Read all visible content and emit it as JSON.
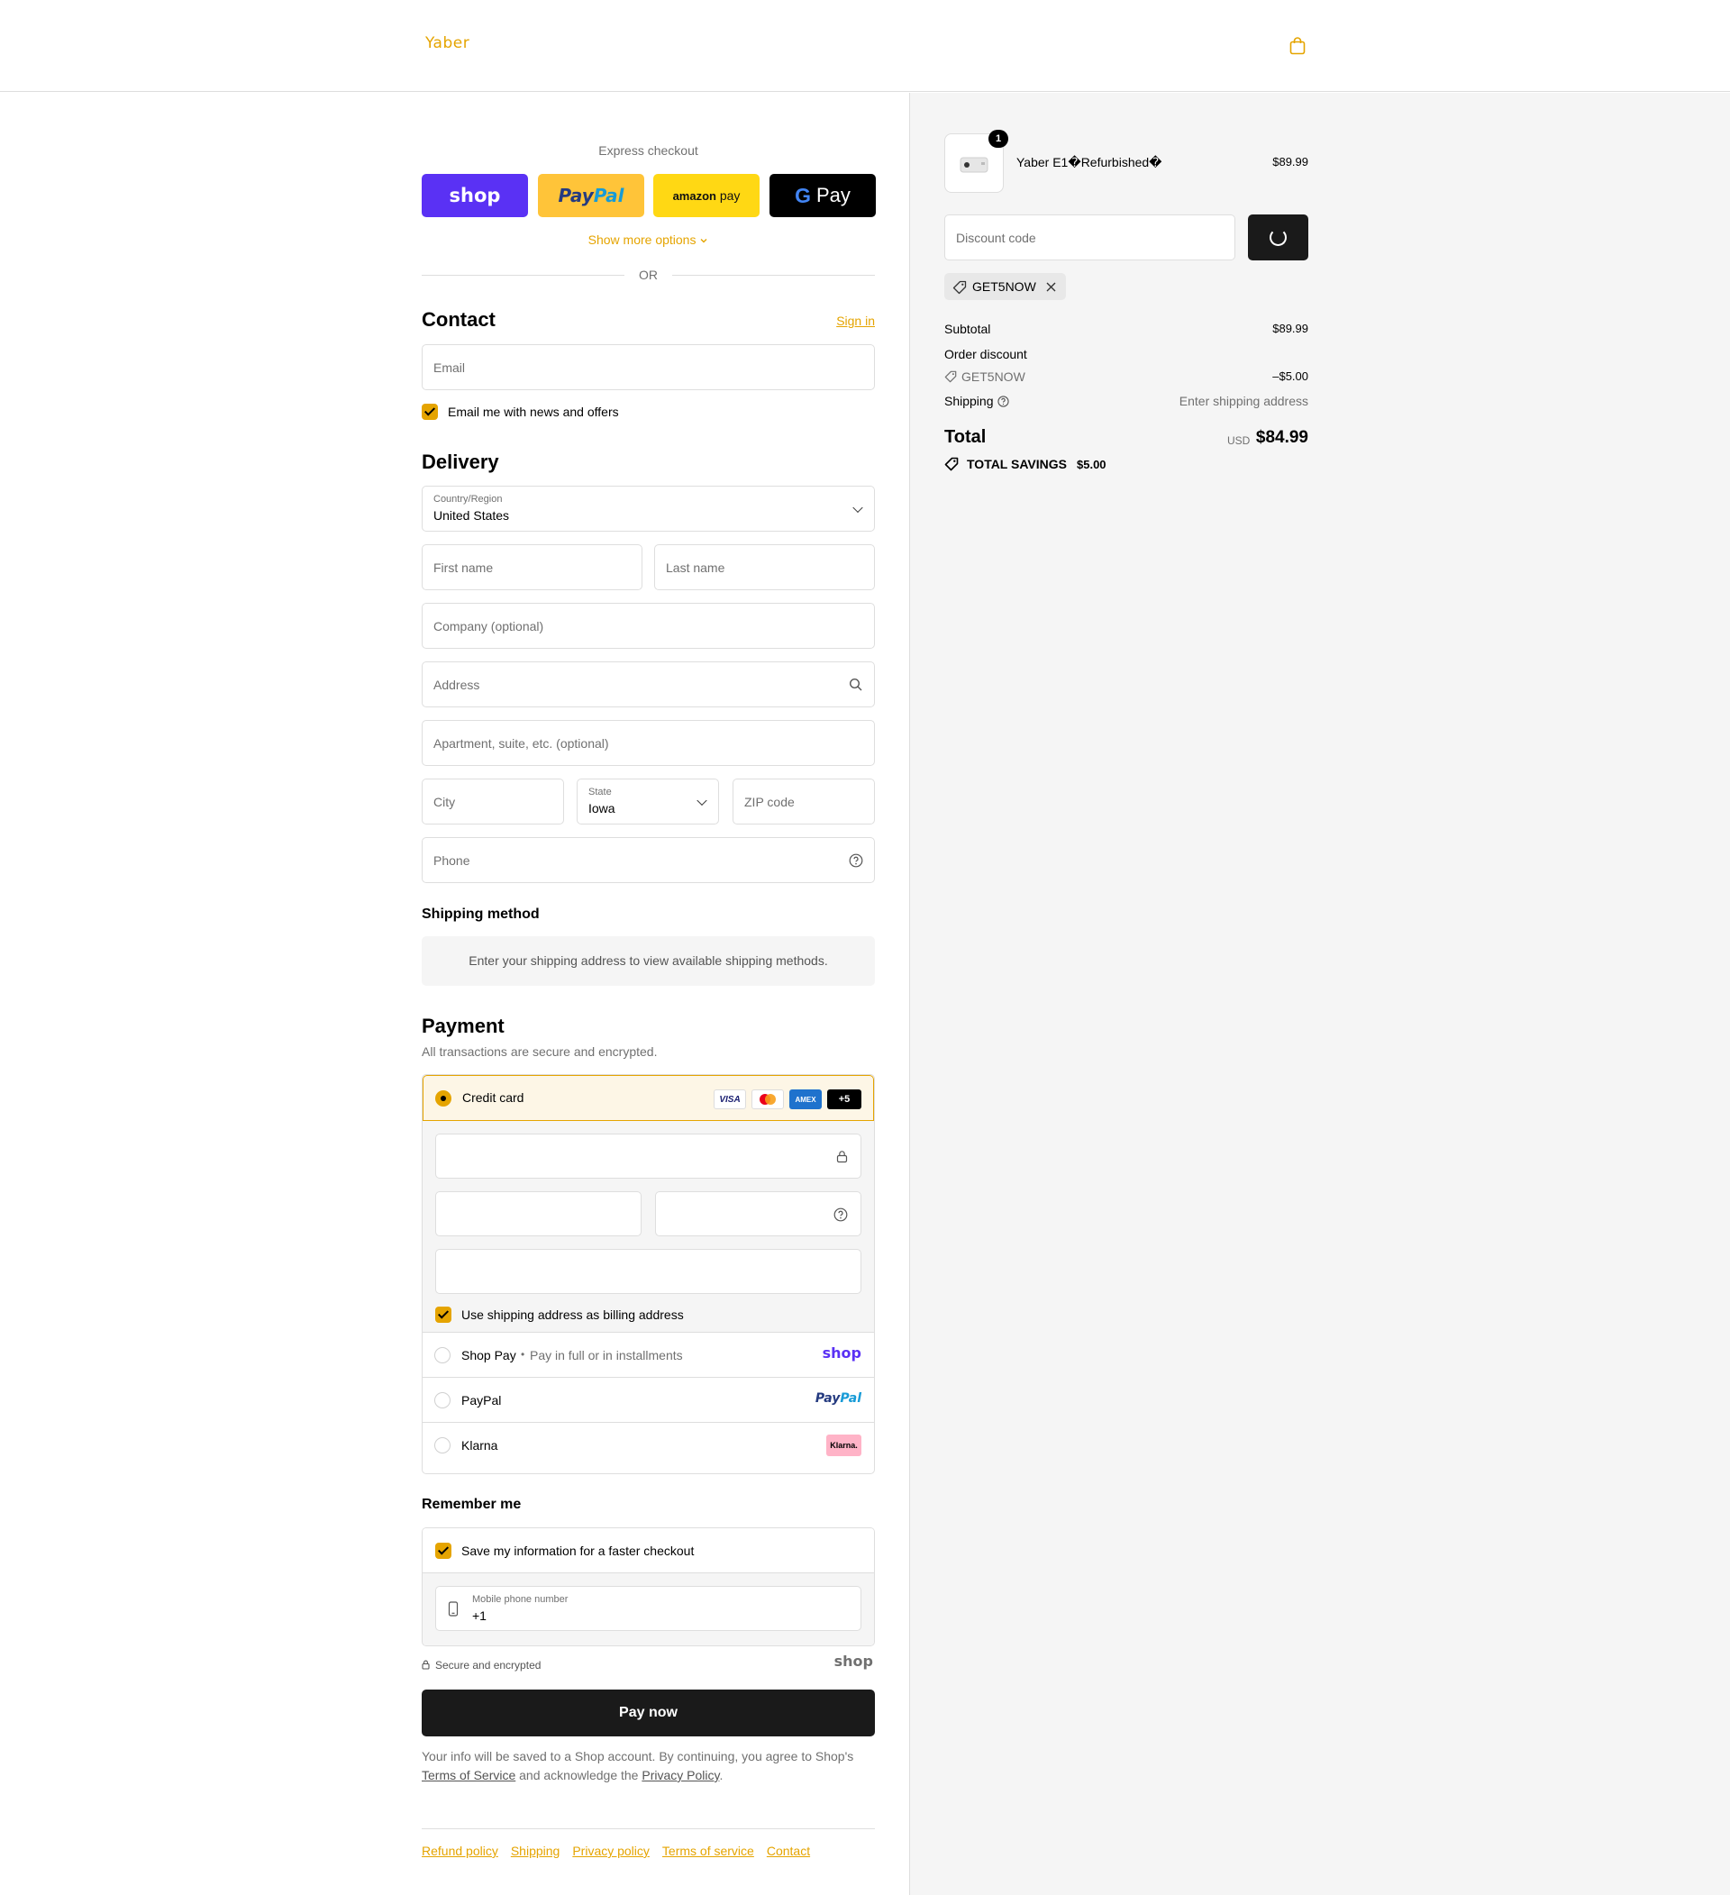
{
  "header": {
    "logo": "Yaber",
    "cart_icon": "shopping-bag-icon"
  },
  "express": {
    "title": "Express checkout",
    "shop_label": "shop",
    "paypal_a": "Pay",
    "paypal_b": "Pal",
    "amazon_a": "amazon",
    "amazon_b": " pay",
    "gpay_g": "G",
    "gpay_label": "Pay",
    "more_options": "Show more options",
    "or": "OR"
  },
  "contact": {
    "title": "Contact",
    "sign_in": "Sign in",
    "email_placeholder": "Email",
    "news_label": "Email me with news and offers"
  },
  "delivery": {
    "title": "Delivery",
    "country_label": "Country/Region",
    "country_value": "United States",
    "first_name": "First name",
    "last_name": "Last name",
    "company": "Company (optional)",
    "address": "Address",
    "apartment": "Apartment, suite, etc. (optional)",
    "city": "City",
    "state_label": "State",
    "state_value": "Iowa",
    "zip": "ZIP code",
    "phone": "Phone"
  },
  "shipping": {
    "title": "Shipping method",
    "message": "Enter your shipping address to view available shipping methods."
  },
  "payment": {
    "title": "Payment",
    "subtitle": "All transactions are secure and encrypted.",
    "credit_card": "Credit card",
    "card_logos": {
      "visa": "VISA",
      "amex": "AMEX",
      "more": "+5"
    },
    "billing_same": "Use shipping address as billing address",
    "shop_pay": "Shop Pay",
    "shop_pay_sep": "•",
    "shop_pay_desc": "Pay in full or in installments",
    "shop_pay_logo": "shop",
    "paypal": "PayPal",
    "paypal_logo_a": "Pay",
    "paypal_logo_b": "Pal",
    "klarna": "Klarna",
    "klarna_logo": "Klarna."
  },
  "remember": {
    "title": "Remember me",
    "save_label": "Save my information for a faster checkout",
    "mobile_label": "Mobile phone number",
    "mobile_value": "+1",
    "secure": "Secure and encrypted",
    "shop_logo": "shop"
  },
  "pay_now": "Pay now",
  "legal": {
    "part1": "Your info will be saved to a Shop account. By continuing, you agree to Shop's",
    "tos": "Terms of Service",
    "part2": " and acknowledge the ",
    "privacy": "Privacy Policy",
    "part3": "."
  },
  "footer_links": [
    "Refund policy",
    "Shipping",
    "Privacy policy",
    "Terms of service",
    "Contact"
  ],
  "summary": {
    "quantity": "1",
    "product_name": "Yaber E1�Refurbished�",
    "product_price": "$89.99",
    "discount_placeholder": "Discount code",
    "applied_code": "GET5NOW",
    "subtotal_label": "Subtotal",
    "subtotal_value": "$89.99",
    "order_discount_label": "Order discount",
    "discount_code": "GET5NOW",
    "discount_value": "–$5.00",
    "shipping_label": "Shipping",
    "shipping_value": "Enter shipping address",
    "total_label": "Total",
    "currency": "USD",
    "total_value": "$84.99",
    "savings_label": "TOTAL SAVINGS",
    "savings_value": "$5.00"
  },
  "colors": {
    "accent": "#e5a400",
    "shop_purple": "#5a31f4",
    "dark": "#1a1a1a"
  }
}
